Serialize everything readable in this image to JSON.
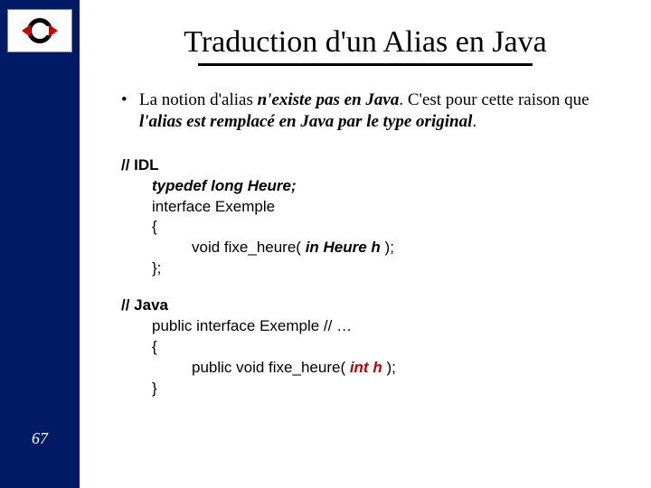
{
  "page_number": "67",
  "title": "Traduction d'un Alias en Java",
  "bullet": {
    "lead": "La notion d'alias ",
    "em1": "n'existe pas en Java",
    "mid": ". C'est pour cette raison que ",
    "em2": "l'alias est remplacé en Java par le type original",
    "tail": "."
  },
  "idl": {
    "comment": "// IDL",
    "typedef": "typedef long Heure;",
    "iface": "interface Exemple",
    "open": "{",
    "fn_pre": "void fixe_heure( ",
    "fn_arg": "in Heure h",
    "fn_post": " );",
    "close": "};"
  },
  "java": {
    "comment": "// Java",
    "iface": "public interface Exemple // …",
    "open": "{",
    "fn_pre": "public void fixe_heure( ",
    "fn_arg": "int h",
    "fn_post": " );",
    "close": "}"
  }
}
